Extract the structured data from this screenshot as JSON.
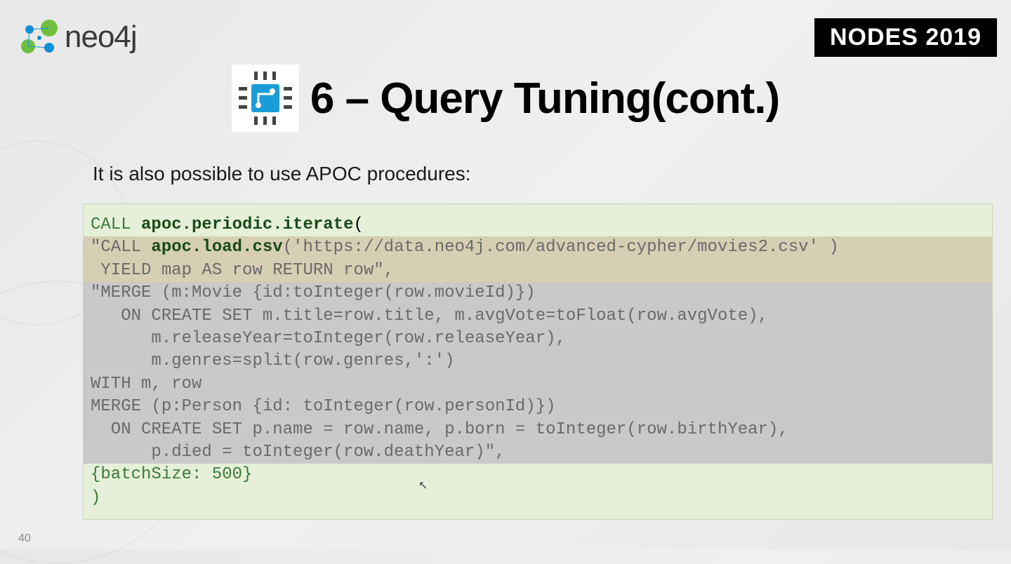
{
  "logo_text": "neo4j",
  "event_badge": "NODES 2019",
  "title": "6 – Query Tuning(cont.)",
  "intro": "It is also possible to use APOC procedures:",
  "code": {
    "l1a": "CALL ",
    "l1b": "apoc.periodic.iterate",
    "l1c": "(",
    "l2a": "\"CALL ",
    "l2b": "apoc.load.csv",
    "l2c": "('https://data.neo4j.com/advanced-cypher/movies2.csv' )",
    "l3": " YIELD map AS row RETURN row\",",
    "l4": "\"MERGE (m:Movie {id:toInteger(row.movieId)})",
    "l5": "   ON CREATE SET m.title=row.title, m.avgVote=toFloat(row.avgVote),",
    "l6": "      m.releaseYear=toInteger(row.releaseYear),",
    "l7": "      m.genres=split(row.genres,':')",
    "l8": "WITH m, row",
    "l9": "MERGE (p:Person {id: toInteger(row.personId)})",
    "l10": "  ON CREATE SET p.name = row.name, p.born = toInteger(row.birthYear),",
    "l11": "      p.died = toInteger(row.deathYear)\",",
    "l12": "{batchSize: 500}",
    "l13": ")"
  },
  "page_number": "40"
}
